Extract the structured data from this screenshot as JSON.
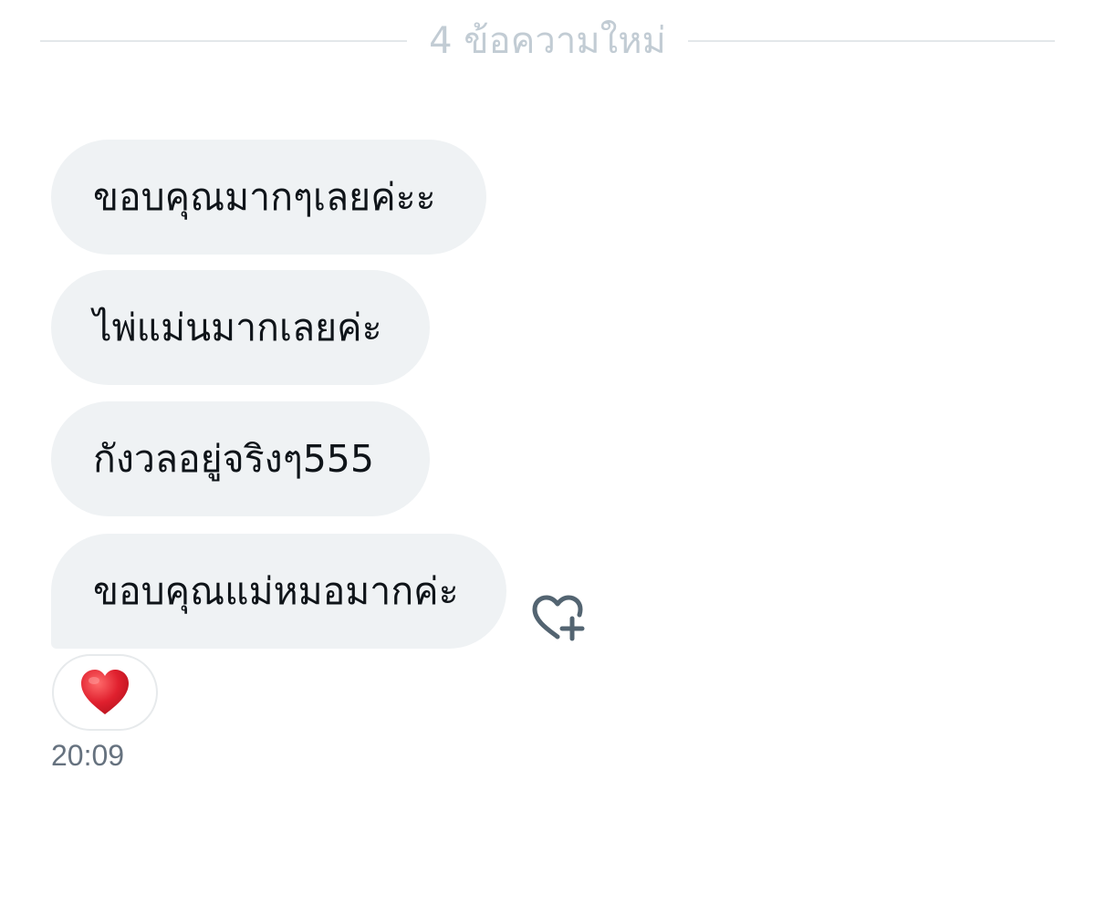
{
  "divider": {
    "label": "4 ข้อความใหม่"
  },
  "messages": [
    {
      "text": "ขอบคุณมากๆเลยค่ะะ"
    },
    {
      "text": "ไพ่แม่นมากเลยค่ะ"
    },
    {
      "text": "กังวลอยู่จริงๆ555"
    },
    {
      "text": "ขอบคุณแม่หมอมากค่ะ"
    }
  ],
  "reaction": {
    "emoji": "red-heart",
    "color": "#e0202e"
  },
  "add_reaction_icon": "heart-plus-icon",
  "timestamp": "20:09"
}
